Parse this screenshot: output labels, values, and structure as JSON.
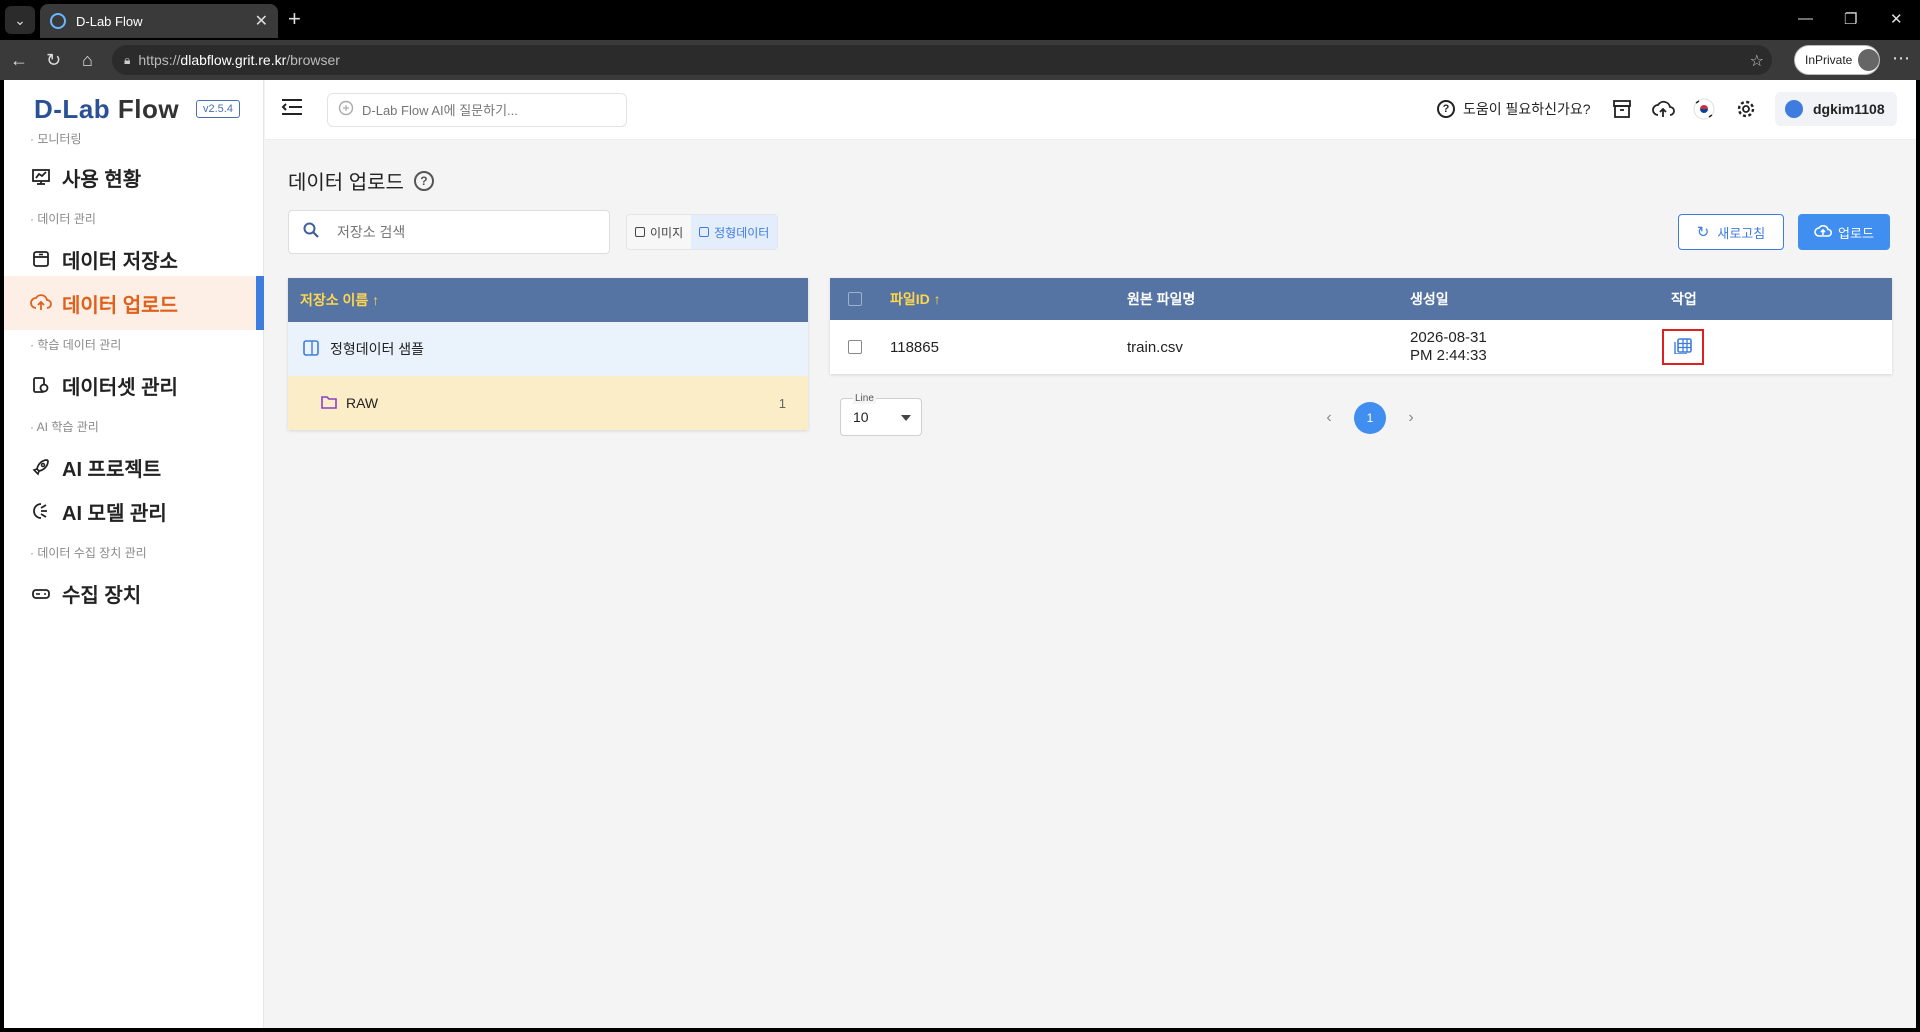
{
  "browser": {
    "tab_title": "D-Lab Flow",
    "url_prefix": "https://",
    "url_host": "dlabflow.grit.re.kr",
    "url_path": "/browser",
    "inprivate_label": "InPrivate"
  },
  "app": {
    "logo_dlab": "D-Lab",
    "logo_flow": "Flow",
    "version": "v2.5.4",
    "ai_placeholder": "D-Lab Flow AI에 질문하기...",
    "help_label": "도움이 필요하신가요?",
    "username": "dgkim1108"
  },
  "sidebar": {
    "sections": [
      {
        "label": "· 모니터링"
      },
      {
        "label": "· 데이터 관리"
      },
      {
        "label": "· 학습 데이터 관리"
      },
      {
        "label": "· AI 학습 관리"
      },
      {
        "label": "· 데이터 수집 장치 관리"
      }
    ],
    "items": [
      {
        "label": "사용 현황",
        "icon": "chart-icon"
      },
      {
        "label": "데이터 저장소",
        "icon": "storage-icon"
      },
      {
        "label": "데이터 업로드",
        "icon": "cloud-upload-icon",
        "active": true
      },
      {
        "label": "데이터셋 관리",
        "icon": "dataset-icon"
      },
      {
        "label": "AI 프로젝트",
        "icon": "rocket-icon"
      },
      {
        "label": "AI 모델 관리",
        "icon": "model-icon"
      },
      {
        "label": "수집 장치",
        "icon": "device-icon"
      }
    ]
  },
  "page": {
    "title": "데이터 업로드",
    "search_placeholder": "저장소 검색",
    "type_tabs": [
      {
        "label": "이미지"
      },
      {
        "label": "정형데이터",
        "active": true
      }
    ],
    "refresh_label": "새로고침",
    "upload_label": "업로드"
  },
  "storage": {
    "header": "저장소 이름 ↑",
    "repo_name": "정형데이터 샘플",
    "folder_name": "RAW",
    "folder_count": "1"
  },
  "files": {
    "columns": [
      "파일ID ↑",
      "원본 파일명",
      "생성일",
      "작업"
    ],
    "rows": [
      {
        "id": "118865",
        "name": "train.csv",
        "date": "2026-08-31",
        "time": "PM 2:44:33"
      }
    ]
  },
  "pagination": {
    "line_label": "Line",
    "line_value": "10",
    "current_page": "1"
  },
  "colors": {
    "accent": "#3f7ce0",
    "active_menu": "#e0601a",
    "table_header": "#5574a3",
    "sort_header_text": "#ffd64d"
  }
}
